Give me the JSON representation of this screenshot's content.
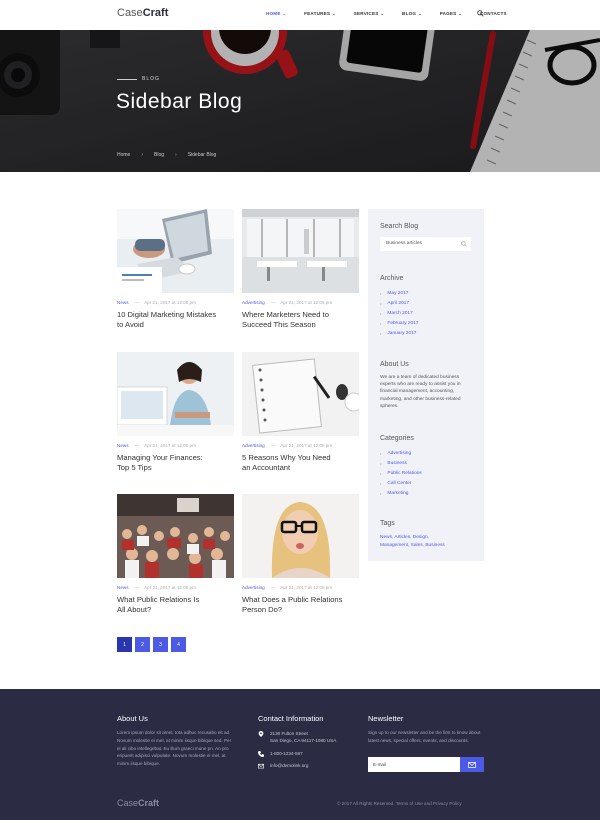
{
  "header": {
    "logo_light": "Case",
    "logo_bold": "Craft",
    "nav": [
      {
        "label": "HOME",
        "caret": "⌄",
        "active": true
      },
      {
        "label": "FEATURES",
        "caret": "⌄"
      },
      {
        "label": "SERVICES",
        "caret": "⌄"
      },
      {
        "label": "BLOG",
        "caret": "⌄"
      },
      {
        "label": "PAGES",
        "caret": "⌄"
      },
      {
        "label": "CONTACTS",
        "caret": ""
      }
    ]
  },
  "hero": {
    "eyebrow": "BLOG",
    "title": "Sidebar Blog",
    "breadcrumb": [
      "Home",
      "Blog",
      "Sidebar Blog"
    ],
    "breadcrumb_sep": "›"
  },
  "posts": [
    {
      "category": "News",
      "date": "Apr 21, 2017 at 12:05 pm",
      "title_line1": "10 Digital Marketing Mistakes",
      "title_line2": "to Avoid"
    },
    {
      "category": "Advertising",
      "date": "Apr 21, 2017 at 12:05 pm",
      "title_line1": "Where Marketers Need to",
      "title_line2": "Succeed This Season"
    },
    {
      "category": "News",
      "date": "Apr 21, 2017 at 12:05 pm",
      "title_line1": "Managing Your Finances:",
      "title_line2": "Top 5 Tips"
    },
    {
      "category": "Advertising",
      "date": "Apr 21, 2017 at 12:05 pm",
      "title_line1": "5 Reasons Why You Need",
      "title_line2": "an Accountant"
    },
    {
      "category": "News",
      "date": "Apr 21, 2017 at 12:05 pm",
      "title_line1": "What Public Relations Is",
      "title_line2": "All About?"
    },
    {
      "category": "Advertising",
      "date": "Apr 21, 2017 at 12:05 pm",
      "title_line1": "What Does a Public Relations",
      "title_line2": "Person Do?"
    }
  ],
  "meta_dash": "—",
  "pagination": [
    "1",
    "2",
    "3",
    "4"
  ],
  "sidebar": {
    "search_heading": "Search Blog",
    "search_value": "Business articles",
    "archive_heading": "Archive",
    "archive": [
      "May 2017",
      "April 2017",
      "March 2017",
      "February 2017",
      "January 2017"
    ],
    "about_heading": "About Us",
    "about_text": "We are a team of dedicated business experts who are ready to assist you in financial management, accounting, marketing, and other business-related spheres.",
    "categories_heading": "Categories",
    "categories": [
      "Advertising",
      "Business",
      "Public Relations",
      "Call Center",
      "Marketing"
    ],
    "tags_heading": "Tags",
    "tags_line1": "News, Articles, Design,",
    "tags_line2": "Management, Sales, Business",
    "bullet": "•"
  },
  "footer": {
    "about_heading": "About Us",
    "about_text": "Lorem ipsum dolor sit amet, tota adhuc recusabo eit ad. Novum molestie ei mel, at minim iisque bibique sed. Per ei ali cibo intellegebat. Eu illum graeci mune pn. An pro eripuerit adipisci vulputate. Novum molestie ei mel, at minim iisque bibique.",
    "contact_heading": "Contact Information",
    "address_line1": "2130 Fulton Street",
    "address_line2": "San Diego, CA 94117-1080 USA",
    "phone": "1-800-1234-567",
    "email": "info@demolink.org",
    "newsletter_heading": "Newsletter",
    "newsletter_text": "Sign up to our newsletter and be the first to know about latest news, special offers, events, and discounts.",
    "email_placeholder": "E-mail",
    "logo_light": "Case",
    "logo_bold": "Craft",
    "copyright": "© 2017 All Rights Reserved. Terms of Use and Privacy Policy"
  },
  "colors": {
    "accent": "#4d5ae6",
    "footer_bg": "#2b2b44",
    "sidebar_bg": "#f1f2f7"
  }
}
